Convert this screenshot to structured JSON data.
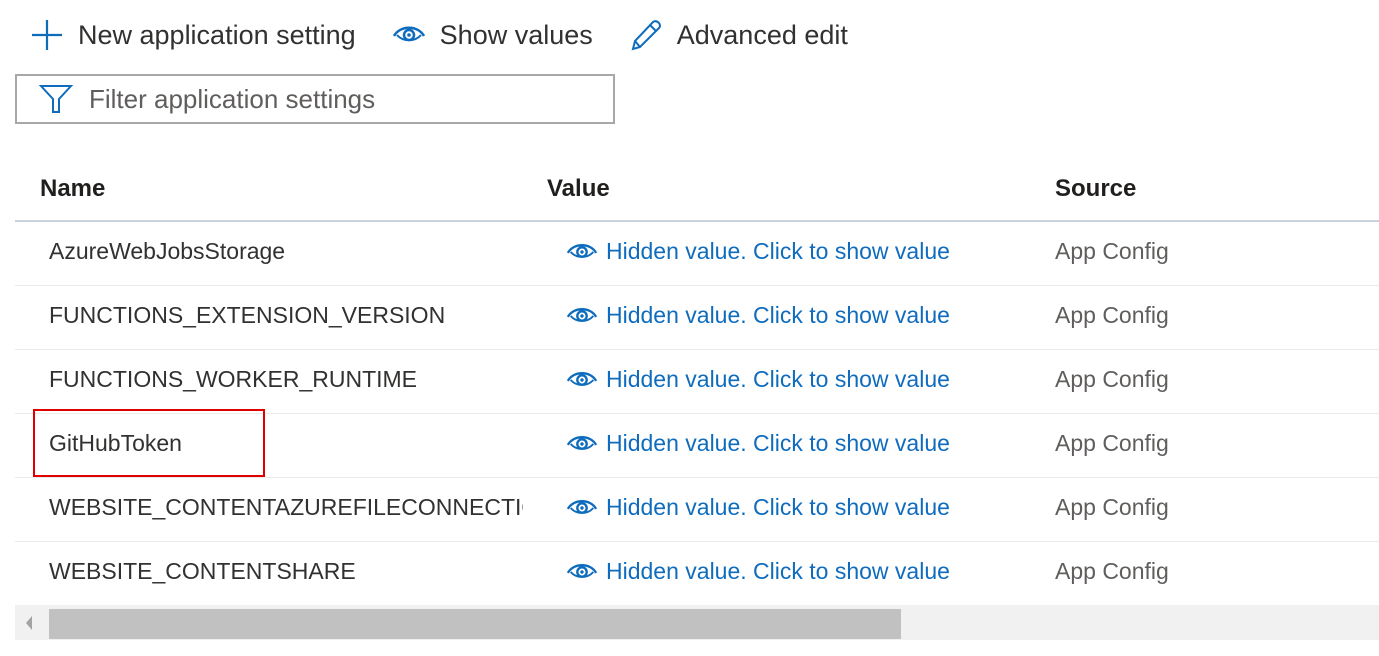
{
  "toolbar": {
    "new_label": "New application setting",
    "show_label": "Show values",
    "advanced_label": "Advanced edit"
  },
  "filter": {
    "placeholder": "Filter application settings"
  },
  "table": {
    "headers": {
      "name": "Name",
      "value": "Value",
      "source": "Source"
    },
    "rows": [
      {
        "name": "AzureWebJobsStorage",
        "value": "Hidden value. Click to show value",
        "source": "App Config"
      },
      {
        "name": "FUNCTIONS_EXTENSION_VERSION",
        "value": "Hidden value. Click to show value",
        "source": "App Config"
      },
      {
        "name": "FUNCTIONS_WORKER_RUNTIME",
        "value": "Hidden value. Click to show value",
        "source": "App Config"
      },
      {
        "name": "GitHubToken",
        "value": "Hidden value. Click to show value",
        "source": "App Config"
      },
      {
        "name": "WEBSITE_CONTENTAZUREFILECONNECTIONSTRING",
        "value": "Hidden value. Click to show value",
        "source": "App Config"
      },
      {
        "name": "WEBSITE_CONTENTSHARE",
        "value": "Hidden value. Click to show value",
        "source": "App Config"
      }
    ]
  },
  "colors": {
    "accent": "#0f6cbd",
    "highlight": "#e00000"
  }
}
